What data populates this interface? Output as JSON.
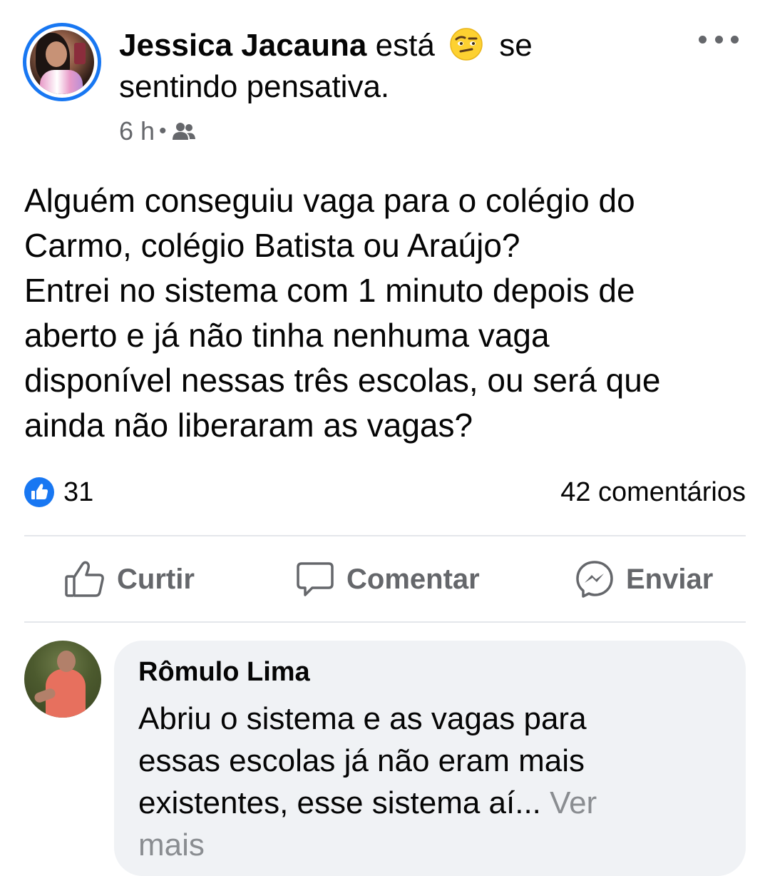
{
  "post": {
    "author_name": "Jessica Jacauna",
    "feeling_prefix": "está",
    "feeling_emoji": "thinking-face-emoji",
    "feeling_suffix": "se",
    "feeling_line2": "sentindo pensativa.",
    "time": "6 h",
    "separator": "•",
    "audience_icon": "friends-icon",
    "text_lines": [
      "Alguém conseguiu vaga para o colégio do",
      "Carmo, colégio Batista ou Araújo?",
      "Entrei no sistema com 1 minuto depois de",
      "aberto e já não tinha nenhuma vaga",
      "disponível nessas três escolas, ou será que",
      "ainda não liberaram as vagas?"
    ],
    "reaction_count": "31",
    "comment_count": "42 comentários"
  },
  "actions": {
    "like_label": "Curtir",
    "comment_label": "Comentar",
    "send_label": "Enviar"
  },
  "comment": {
    "author": "Rômulo Lima",
    "text_lines": [
      "Abriu o sistema e as vagas para",
      "essas escolas já não eram mais",
      "existentes, esse sistema aí..."
    ],
    "see_more_part1": "Ver",
    "see_more_part2": "mais"
  },
  "colors": {
    "accent": "#1877f2",
    "secondary_text": "#65676b",
    "bubble": "#f0f2f5"
  }
}
